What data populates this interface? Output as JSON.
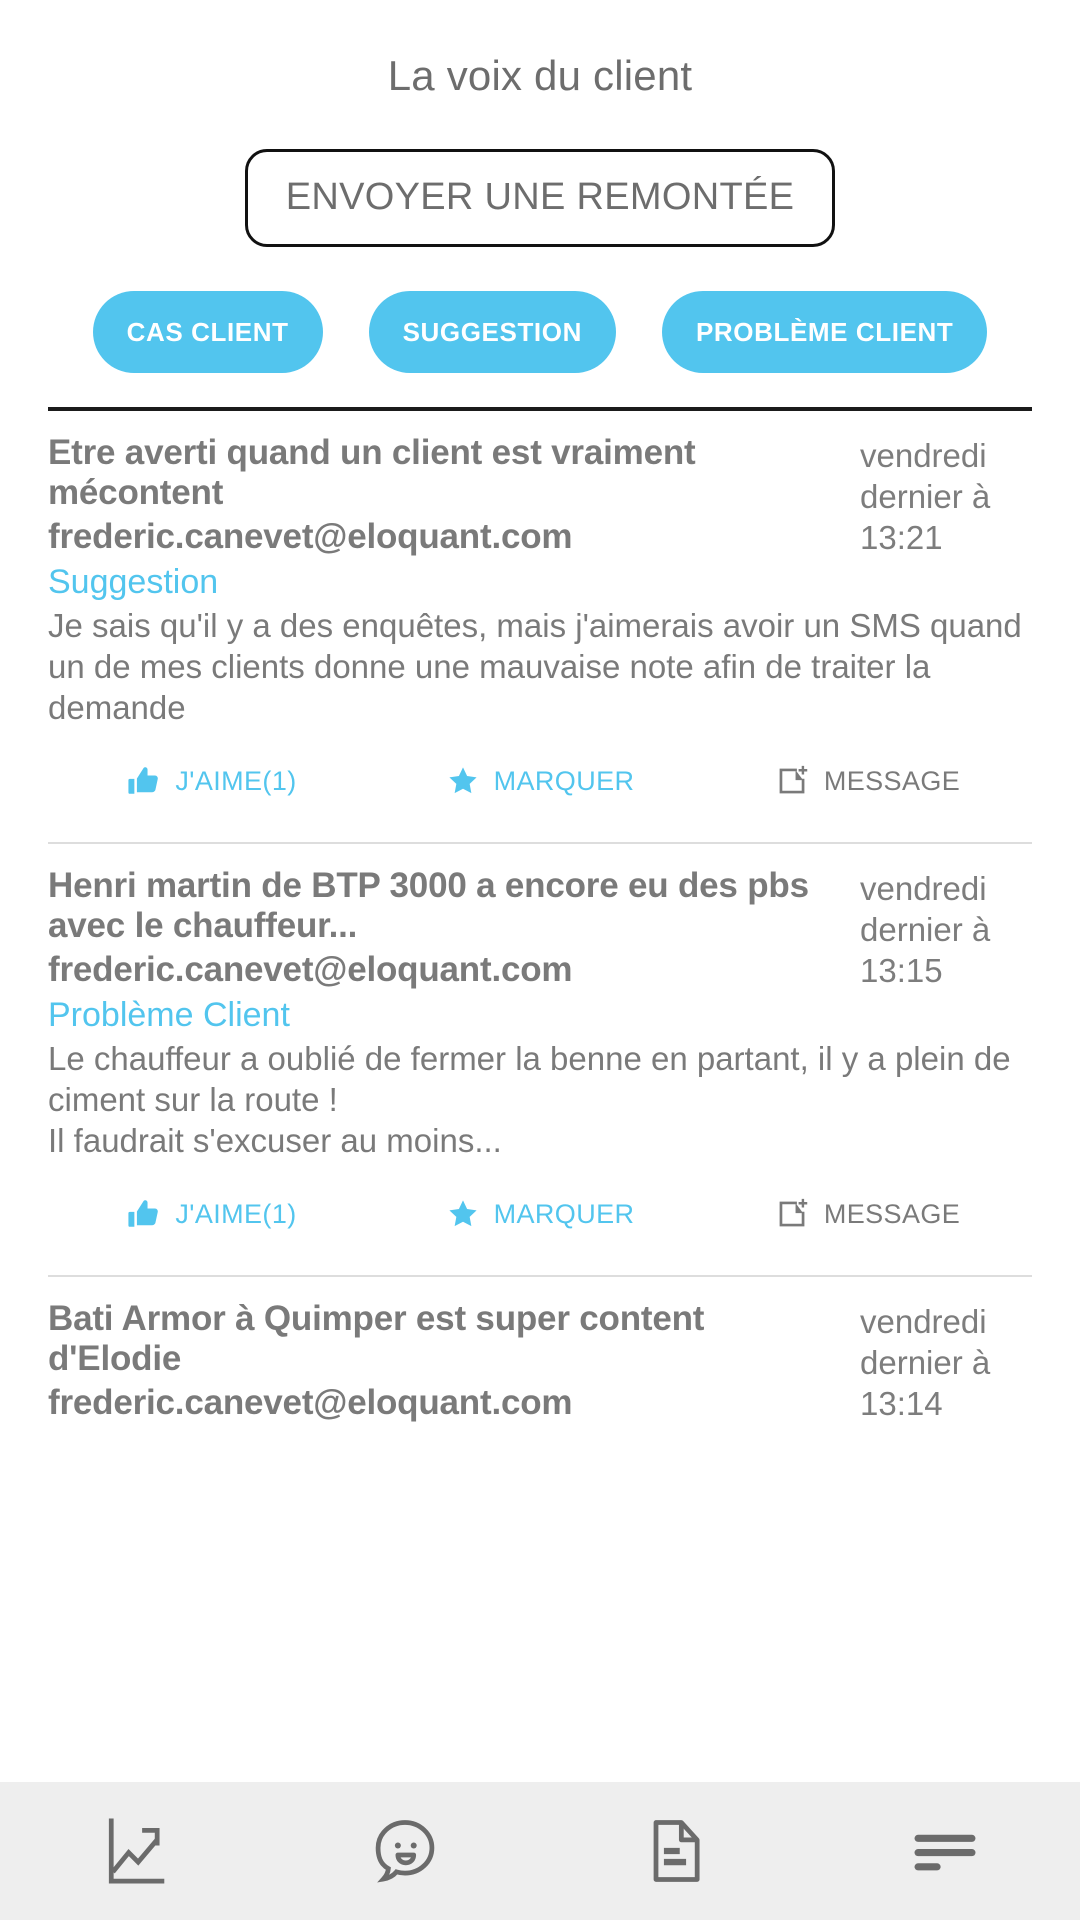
{
  "header": {
    "title": "La voix du client"
  },
  "primary_action": {
    "label": "ENVOYER UNE REMONTÉE"
  },
  "filters": [
    {
      "label": "CAS CLIENT",
      "name": "pill-cas-client"
    },
    {
      "label": "SUGGESTION",
      "name": "pill-suggestion"
    },
    {
      "label": "PROBLÈME CLIENT",
      "name": "pill-probleme-client"
    }
  ],
  "colors": {
    "accent": "#52c5ee",
    "text_gray": "#7a7a7a",
    "title_gray": "#6d6d6d",
    "nav_bg": "#eeeeee",
    "rule": "#1b1b1b"
  },
  "actions": {
    "like": "J'AIME(1)",
    "mark": "MARQUER",
    "message": "MESSAGE"
  },
  "posts": [
    {
      "title": "Etre averti quand un client est vraiment mécontent",
      "email": "frederic.canevet@eloquant.com",
      "category": "Suggestion",
      "date": "vendredi dernier à 13:21",
      "body": "Je sais qu'il y a des enquêtes, mais j'aimerais avoir un SMS quand un de mes clients donne une mauvaise note afin de traiter la demande"
    },
    {
      "title": "Henri martin de BTP 3000 a encore eu des pbs avec le chauffeur...",
      "email": "frederic.canevet@eloquant.com",
      "category": "Problème Client",
      "date": "vendredi dernier à 13:15",
      "body": "Le chauffeur a oublié de fermer la benne en partant, il y a plein de ciment sur la route !\nIl faudrait s'excuser au moins..."
    },
    {
      "title": "Bati Armor à Quimper est super content d'Elodie",
      "email": "frederic.canevet@eloquant.com",
      "category": "",
      "date": "vendredi dernier à 13:14",
      "body": ""
    }
  ],
  "bottom_nav": [
    {
      "name": "nav-statistics",
      "icon": "chart-trend-icon"
    },
    {
      "name": "nav-feedback",
      "icon": "smiley-speech-bubble-icon"
    },
    {
      "name": "nav-documents",
      "icon": "document-icon"
    },
    {
      "name": "nav-menu",
      "icon": "hamburger-menu-icon"
    }
  ]
}
